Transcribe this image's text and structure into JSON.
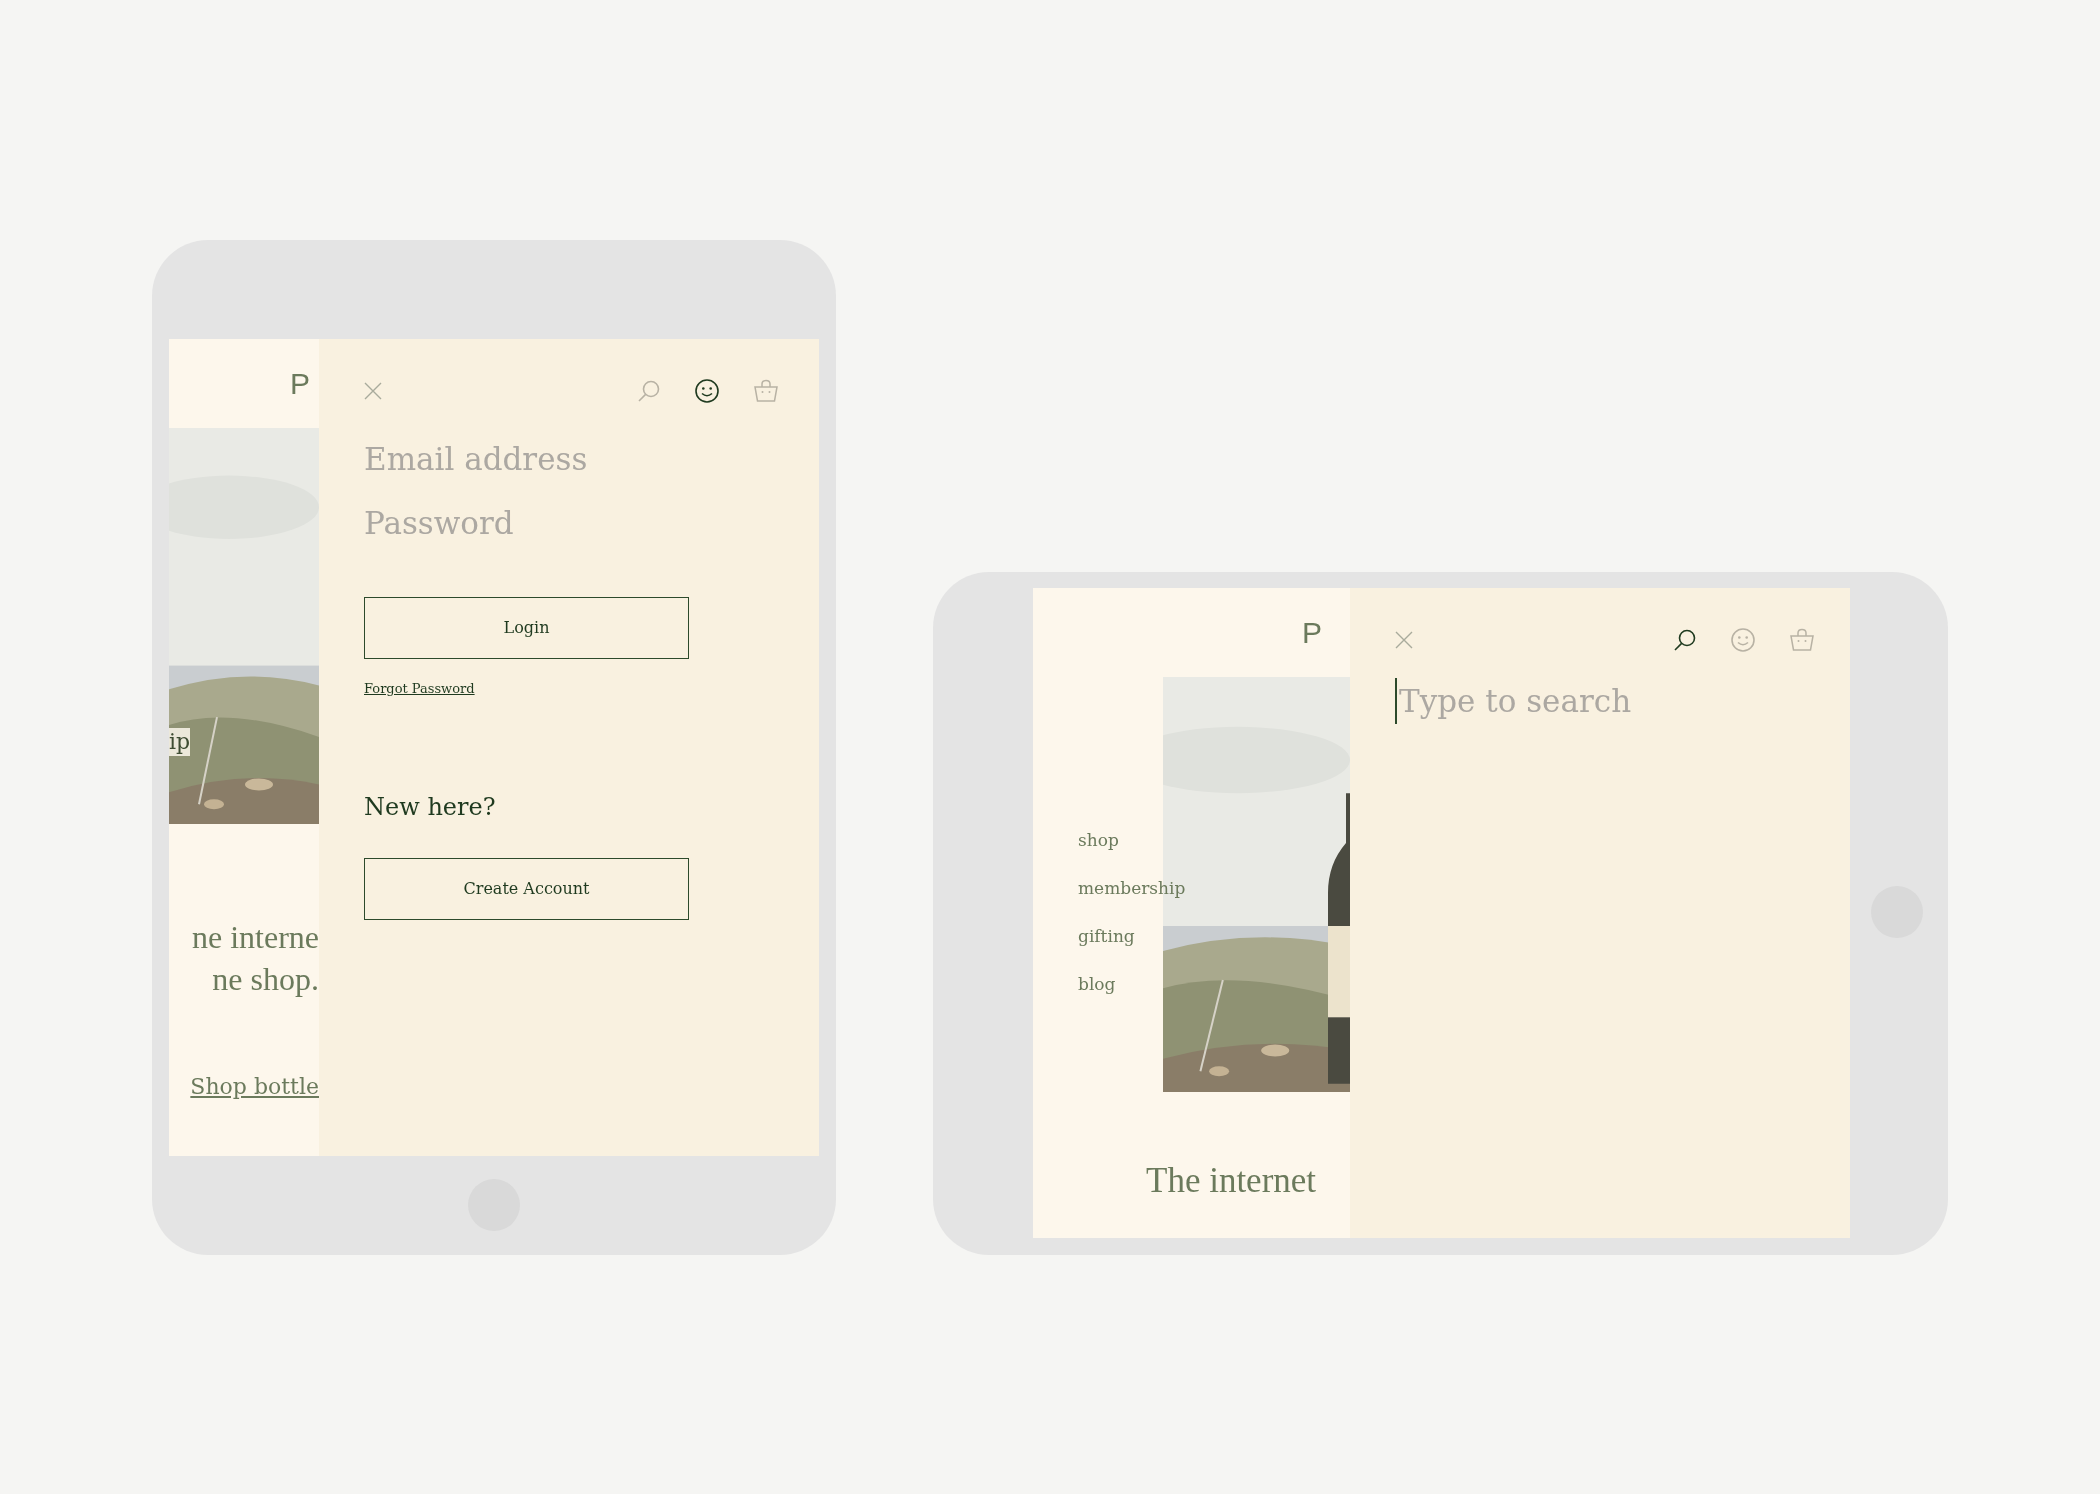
{
  "devices": [
    {
      "kind": "portrait",
      "page": {
        "logo": "P",
        "nav": [
          "ip"
        ],
        "headline": [
          "ne interne",
          "ne shop."
        ],
        "cta": "Shop bottle",
        "photo": {
          "kind": "picture"
        }
      },
      "panel": {
        "kind": "login",
        "icons": [
          {
            "kind": "search",
            "selected": false
          },
          {
            "kind": "account",
            "selected": true
          },
          {
            "kind": "bag",
            "selected": false
          }
        ],
        "fields": [
          {
            "placeholder": "Email address"
          },
          {
            "placeholder": "Password"
          }
        ],
        "login_button": "Login",
        "forgot_link": "Forgot Password",
        "new_heading": "New here?",
        "create_button": "Create Account"
      }
    },
    {
      "kind": "landscape",
      "page": {
        "logo": "P",
        "nav": [
          "shop",
          "membership",
          "gifting",
          "blog"
        ],
        "headline": [
          "The internet"
        ],
        "photo": {
          "kind": "picture"
        }
      },
      "panel": {
        "kind": "search",
        "icons": [
          {
            "kind": "search",
            "selected": true
          },
          {
            "kind": "account",
            "selected": false
          },
          {
            "kind": "bag",
            "selected": false
          }
        ],
        "fields": [
          {
            "placeholder": "Type to search"
          }
        ]
      }
    }
  ]
}
